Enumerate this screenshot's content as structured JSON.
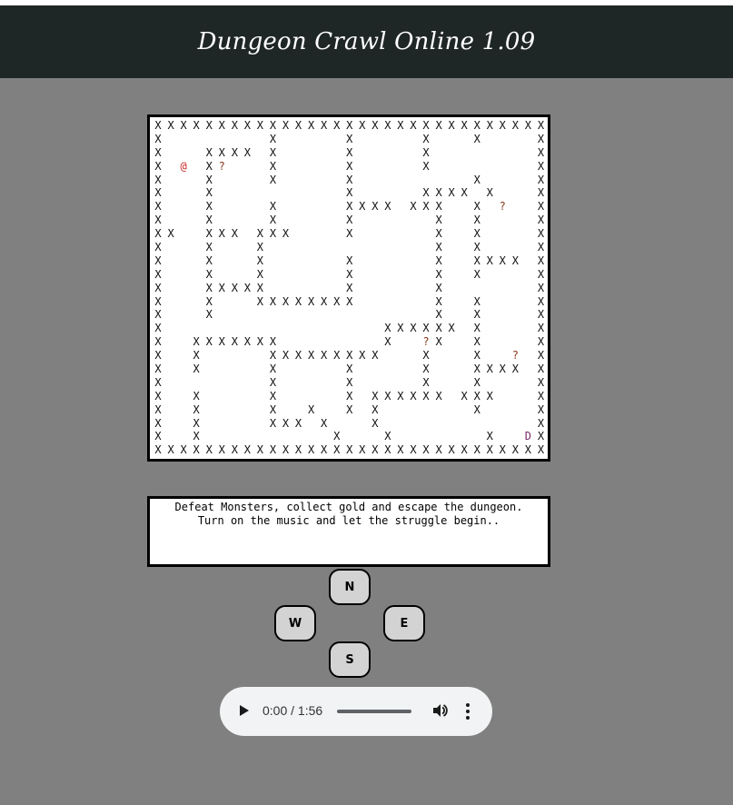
{
  "header": {
    "title": "Dungeon Crawl Online 1.09"
  },
  "map": {
    "rows": [
      "XXXXXXXXXXXXXXXXXXXXXXXXXXXXXXX",
      "X        X     X     X   X    X",
      "X   XXXX X     X     X        X",
      "X @ X?   X     X     X        X",
      "X   X    X     X         X    X",
      "X   X          X     XXXX X   X",
      "X   X    X     XXXX XXX  X ?  X",
      "X   X    X     X      X  X    X",
      "XX  XXX XXX    X      X  X    X",
      "X   X   X             X  X    X",
      "X   X   X      X      X  XXXX X",
      "X   X   X      X      X  X    X",
      "X   XXXXX      X      X       X",
      "X   X   XXXXXXXX      X  X    X",
      "X   X                 X  X    X",
      "X                 XXXXXX X    X",
      "X  XXXXXXX        X  ?X  X    X",
      "X  X     XXXXXXXXX   X   X  ? X",
      "X  X     X     X     X   XXXX X",
      "X        X     X     X   X    X",
      "X  X     X     X XXXXXX XXX   X",
      "X  X     X  X  X X       X    X",
      "X  X     XXX X   X            X",
      "X  X          X   X       X  DX",
      "XXXXXXXXXXXXXXXXXXXXXXXXXXXXXXX"
    ]
  },
  "message": {
    "line1": "Defeat Monsters, collect gold and escape the dungeon.",
    "line2": "Turn on the music and let the struggle begin.."
  },
  "controls": {
    "north": "N",
    "west": "W",
    "east": "E",
    "south": "S"
  },
  "audio": {
    "time": "0:00 / 1:56",
    "progress": 0
  }
}
